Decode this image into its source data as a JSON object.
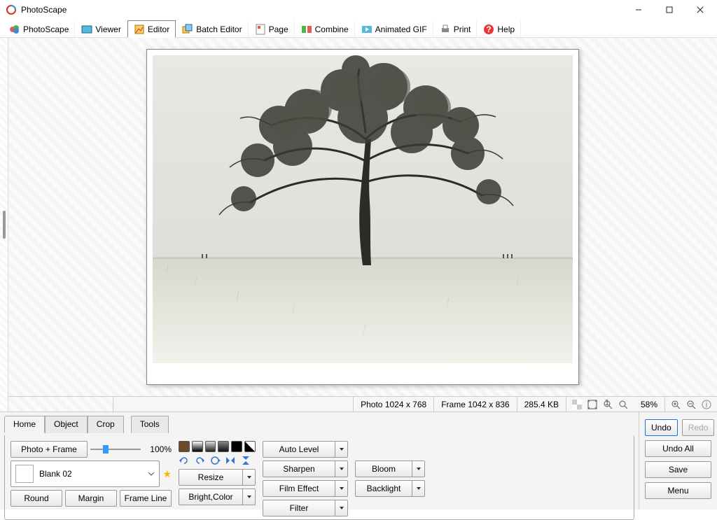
{
  "window": {
    "title": "PhotoScape"
  },
  "maintabs": [
    {
      "label": "PhotoScape"
    },
    {
      "label": "Viewer"
    },
    {
      "label": "Editor",
      "active": true
    },
    {
      "label": "Batch Editor"
    },
    {
      "label": "Page"
    },
    {
      "label": "Combine"
    },
    {
      "label": "Animated GIF"
    },
    {
      "label": "Print"
    },
    {
      "label": "Help"
    }
  ],
  "status": {
    "photo": "Photo 1024 x 768",
    "frame": "Frame 1042 x 836",
    "size": "285.4 KB",
    "zoom": "58%"
  },
  "editor_tabs": [
    {
      "label": "Home",
      "active": true
    },
    {
      "label": "Object"
    },
    {
      "label": "Crop"
    },
    {
      "label": "Tools"
    }
  ],
  "frame_panel": {
    "photo_frame_btn": "Photo + Frame",
    "zoom_pct": "100%",
    "selected_frame": "Blank 02",
    "round_btn": "Round",
    "margin_btn": "Margin",
    "frameline_btn": "Frame Line"
  },
  "tool_buttons": {
    "resize": "Resize",
    "bright": "Bright,Color",
    "auto": "Auto Level",
    "sharpen": "Sharpen",
    "film": "Film Effect",
    "filter": "Filter",
    "bloom": "Bloom",
    "backlight": "Backlight"
  },
  "right_buttons": {
    "undo": "Undo",
    "redo": "Redo",
    "undo_all": "Undo All",
    "save": "Save",
    "menu": "Menu"
  }
}
